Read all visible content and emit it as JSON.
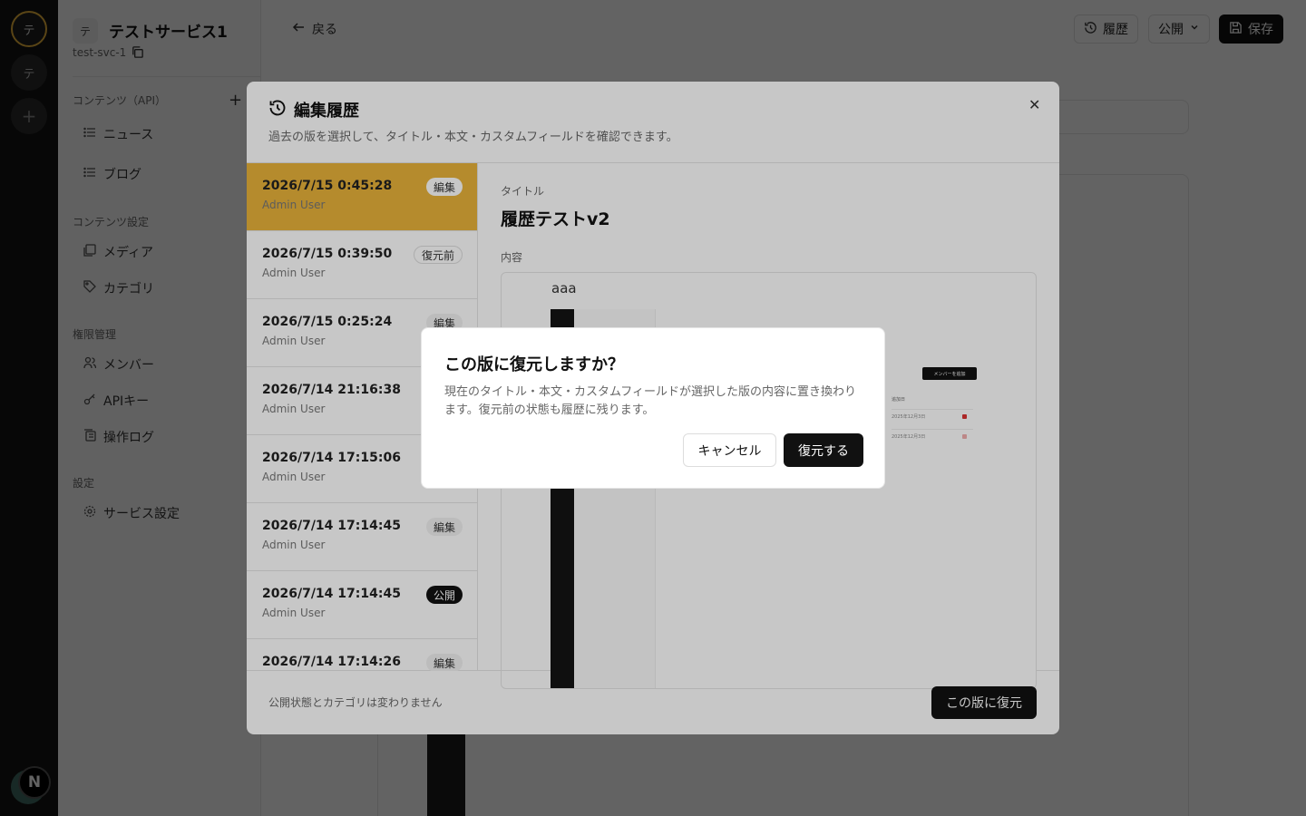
{
  "workspaces": [
    "テ",
    "テ",
    "+"
  ],
  "user_badge": "N",
  "service": {
    "mark": "テ",
    "name": "テストサービス1",
    "id": "test-svc-1"
  },
  "sidebar": {
    "content_api": {
      "label": "コンテンツ（API）",
      "items": [
        {
          "label": "ニュース",
          "icon": "list-icon"
        },
        {
          "label": "ブログ",
          "icon": "list-icon"
        }
      ]
    },
    "content_settings": {
      "label": "コンテンツ設定",
      "items": [
        {
          "label": "メディア",
          "icon": "media-icon"
        },
        {
          "label": "カテゴリ",
          "icon": "tag-icon"
        }
      ]
    },
    "permissions": {
      "label": "権限管理",
      "items": [
        {
          "label": "メンバー",
          "icon": "users-icon"
        },
        {
          "label": "APIキー",
          "icon": "key-icon"
        },
        {
          "label": "操作ログ",
          "icon": "log-icon"
        }
      ]
    },
    "settings": {
      "label": "設定",
      "items": [
        {
          "label": "サービス設定",
          "icon": "gear-icon"
        }
      ]
    }
  },
  "toolbar": {
    "back_label": "戻る",
    "history_label": "履歴",
    "publish_label": "公開",
    "save_label": "保存"
  },
  "history_dialog": {
    "title": "編集履歴",
    "subtitle": "過去の版を選択して、タイトル・本文・カスタムフィールドを確認できます。",
    "versions": [
      {
        "date": "2026/7/15 0:45:28",
        "user": "Admin User",
        "badge": "編集",
        "badge_style": "soft",
        "selected": true
      },
      {
        "date": "2026/7/15 0:39:50",
        "user": "Admin User",
        "badge": "復元前",
        "badge_style": "outline",
        "selected": false
      },
      {
        "date": "2026/7/15 0:25:24",
        "user": "Admin User",
        "badge": "編集",
        "badge_style": "soft",
        "selected": false
      },
      {
        "date": "2026/7/14 21:16:38",
        "user": "Admin User",
        "badge": "",
        "badge_style": "soft",
        "selected": false
      },
      {
        "date": "2026/7/14 17:15:06",
        "user": "Admin User",
        "badge": "",
        "badge_style": "soft",
        "selected": false
      },
      {
        "date": "2026/7/14 17:14:45",
        "user": "Admin User",
        "badge": "編集",
        "badge_style": "soft",
        "selected": false
      },
      {
        "date": "2026/7/14 17:14:45",
        "user": "Admin User",
        "badge": "公開",
        "badge_style": "solid",
        "selected": false
      },
      {
        "date": "2026/7/14 17:14:26",
        "user": "Admin User",
        "badge": "編集",
        "badge_style": "soft",
        "selected": false
      }
    ],
    "detail": {
      "title_label": "タイトル",
      "title_value": "履歴テストv2",
      "content_label": "内容",
      "content_text": "aaa",
      "embedded_image": {
        "add_member_button": "メンバーを追加",
        "table_header": "追加日",
        "rows": [
          "2025年12月3日",
          "2025年12月3日"
        ]
      }
    },
    "footer_note": "公開状態とカテゴリは変わりません",
    "restore_button": "この版に復元"
  },
  "confirm_dialog": {
    "title": "この版に復元しますか？",
    "description": "現在のタイトル・本文・カスタムフィールドが選択した版の内容に置き換わります。復元前の状態も履歴に残ります。",
    "cancel_label": "キャンセル",
    "confirm_label": "復元する"
  },
  "colors": {
    "accent": "#e8b33a",
    "primary": "#111111",
    "danger": "#d33333"
  }
}
